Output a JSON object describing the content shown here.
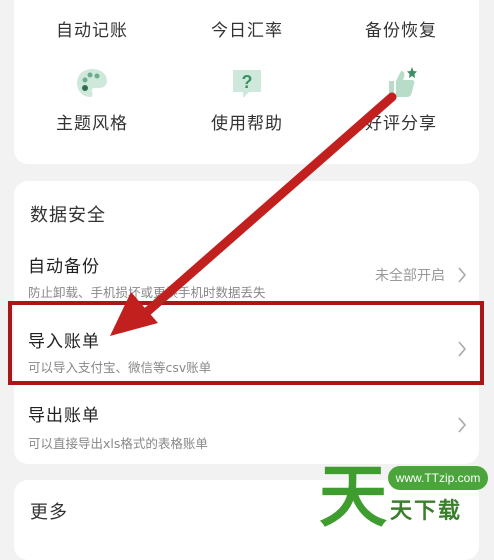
{
  "tools": {
    "row1": [
      "自动记账",
      "今日汇率",
      "备份恢复"
    ],
    "row2": [
      "主题风格",
      "使用帮助",
      "好评分享"
    ]
  },
  "security": {
    "title": "数据安全",
    "auto_backup": {
      "title": "自动备份",
      "subtitle": "防止卸载、手机损坏或更换手机时数据丢失",
      "status": "未全部开启"
    },
    "import_bill": {
      "title": "导入账单",
      "subtitle": "可以导入支付宝、微信等csv账单"
    },
    "export_bill": {
      "title": "导出账单",
      "subtitle": "可以直接导出xls格式的表格账单"
    }
  },
  "more": {
    "title": "更多"
  },
  "watermark": {
    "domain": "www.TTzip.com",
    "name": "天下载",
    "glyph": "天"
  },
  "colors": {
    "accent_green": "#6cae8a",
    "highlight_red": "#a81818",
    "watermark_green": "#3f9d2f"
  }
}
